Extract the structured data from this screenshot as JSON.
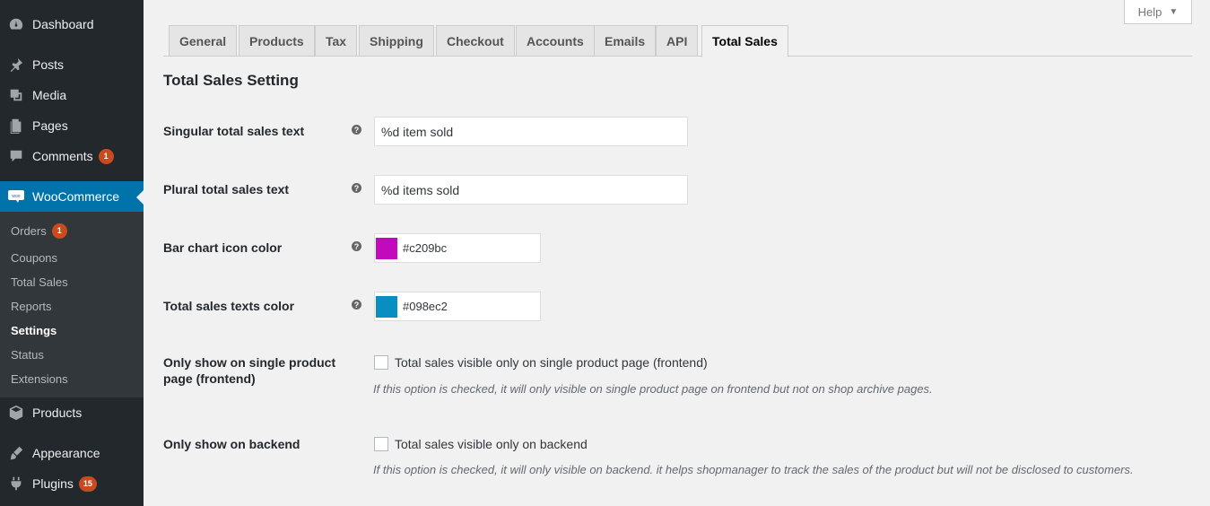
{
  "sidebar": {
    "items": [
      {
        "label": "Dashboard",
        "icon": "dashboard-icon"
      },
      {
        "label": "Posts",
        "icon": "pin-icon"
      },
      {
        "label": "Media",
        "icon": "media-icon"
      },
      {
        "label": "Pages",
        "icon": "pages-icon"
      },
      {
        "label": "Comments",
        "icon": "comment-icon",
        "badge": "1"
      },
      {
        "label": "WooCommerce",
        "icon": "woo-icon"
      },
      {
        "label": "Products",
        "icon": "box-icon"
      },
      {
        "label": "Appearance",
        "icon": "brush-icon"
      },
      {
        "label": "Plugins",
        "icon": "plug-icon",
        "badge": "15"
      }
    ],
    "submenu": [
      {
        "label": "Orders",
        "badge": "1"
      },
      {
        "label": "Coupons"
      },
      {
        "label": "Total Sales"
      },
      {
        "label": "Reports"
      },
      {
        "label": "Settings"
      },
      {
        "label": "Status"
      },
      {
        "label": "Extensions"
      }
    ]
  },
  "help": {
    "label": "Help",
    "caret": "▼"
  },
  "tabs": [
    "General",
    "Products",
    "Tax",
    "Shipping",
    "Checkout",
    "Accounts",
    "Emails",
    "API",
    "Total Sales"
  ],
  "active_tab": "Total Sales",
  "page_title": "Total Sales Setting",
  "settings": {
    "singular": {
      "label": "Singular total sales text",
      "value": "%d item sold"
    },
    "plural": {
      "label": "Plural total sales text",
      "value": "%d items sold"
    },
    "bar_color": {
      "label": "Bar chart icon color",
      "value": "#c209bc"
    },
    "text_color": {
      "label": "Total sales texts color",
      "value": "#098ec2"
    },
    "single_page": {
      "label": "Only show on single product page (frontend)",
      "checkbox_label": "Total sales visible only on single product page (frontend)",
      "description": "If this option is checked, it will only visible on single product page on frontend but not on shop archive pages.",
      "checked": false
    },
    "backend": {
      "label": "Only show on backend",
      "checkbox_label": "Total sales visible only on backend",
      "description": "If this option is checked, it will only visible on backend. it helps shopmanager to track the sales of the product but will not be disclosed to customers.",
      "checked": false
    }
  },
  "tip_glyph": "?",
  "colors": {
    "accent": "#0073aa",
    "sidebar": "#23282d",
    "badge": "#ca4a1f"
  }
}
